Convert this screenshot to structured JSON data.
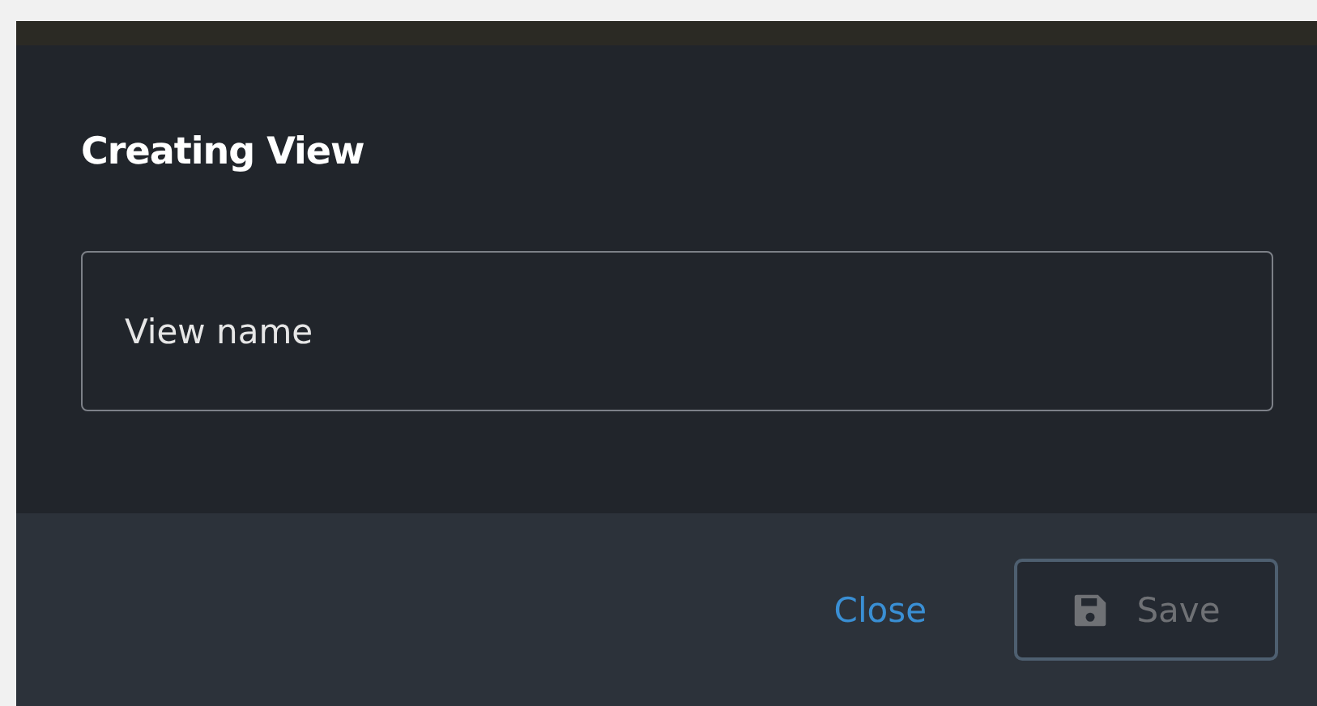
{
  "dialog": {
    "title": "Creating View"
  },
  "name_field": {
    "placeholder": "View name"
  },
  "buttons": [
    {
      "kind": "link",
      "label": "Close",
      "disabled": false
    },
    {
      "kind": "save",
      "label": "Save",
      "disabled": true
    }
  ]
}
